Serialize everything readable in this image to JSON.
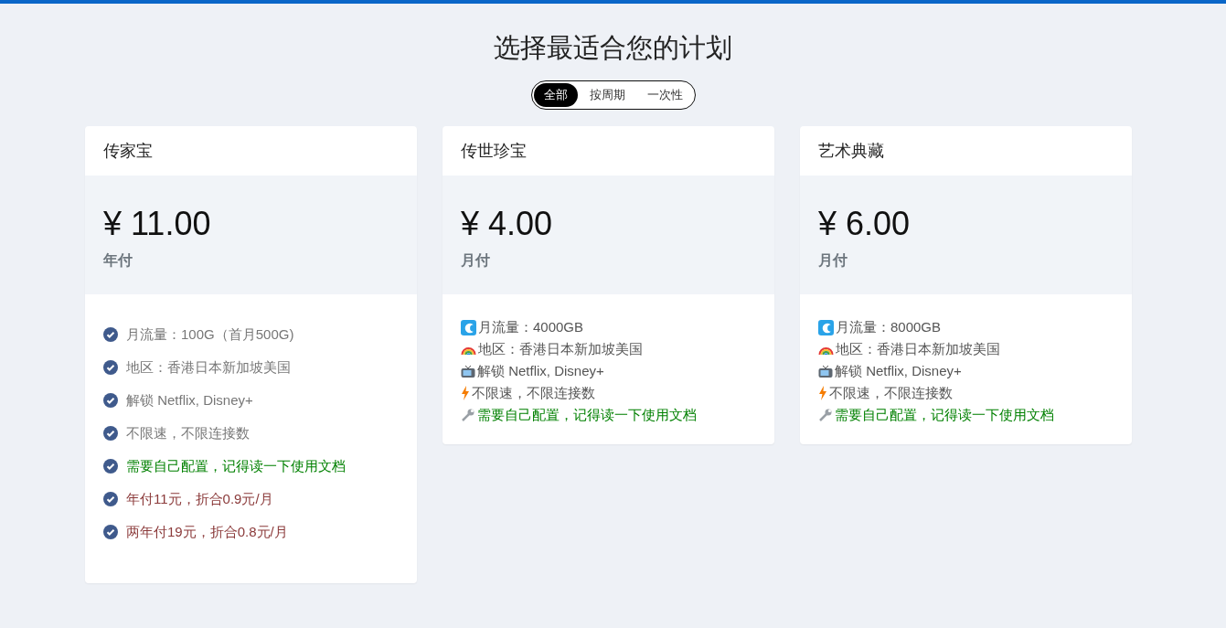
{
  "title": "选择最适合您的计划",
  "filter_tabs": [
    {
      "label": "全部",
      "selected": true
    },
    {
      "label": "按周期",
      "selected": false
    },
    {
      "label": "一次性",
      "selected": false
    }
  ],
  "plans": [
    {
      "kind": "checklist",
      "name": "传家宝",
      "price": "¥ 11.00",
      "period": "年付",
      "features": [
        {
          "text": "月流量：100G（首月500G)",
          "color": "#777777"
        },
        {
          "text": "地区：香港日本新加坡美国",
          "color": "#777777"
        },
        {
          "text": "解锁 Netflix, Disney+",
          "color": "#777777"
        },
        {
          "text": "不限速，不限连接数",
          "color": "#777777"
        },
        {
          "text": "需要自己配置，记得读一下使用文档",
          "color": "#008000"
        },
        {
          "text": "年付11元，折合0.9元/月",
          "color": "#8b3a3a"
        },
        {
          "text": "两年付19元，折合0.8元/月",
          "color": "#8b3a3a"
        }
      ]
    },
    {
      "kind": "emoji",
      "name": "传世珍宝",
      "price": "¥ 4.00",
      "period": "月付",
      "features": [
        {
          "text": "月流量：4000GB",
          "color": "#555555"
        },
        {
          "text": "地区：香港日本新加坡美国",
          "color": "#555555"
        },
        {
          "text": "解锁 Netflix, Disney+",
          "color": "#555555"
        },
        {
          "text": "不限速，不限连接数",
          "color": "#555555"
        },
        {
          "text": "需要自己配置，记得读一下使用文档",
          "color": "#008000"
        }
      ]
    },
    {
      "kind": "emoji",
      "name": "艺术典藏",
      "price": "¥ 6.00",
      "period": "月付",
      "features": [
        {
          "text": "月流量：8000GB",
          "color": "#555555"
        },
        {
          "text": "地区：香港日本新加坡美国",
          "color": "#555555"
        },
        {
          "text": "解锁 Netflix, Disney+",
          "color": "#555555"
        },
        {
          "text": "不限速，不限连接数",
          "color": "#555555"
        },
        {
          "text": "需要自己配置，记得读一下使用文档",
          "color": "#008000"
        }
      ]
    }
  ]
}
